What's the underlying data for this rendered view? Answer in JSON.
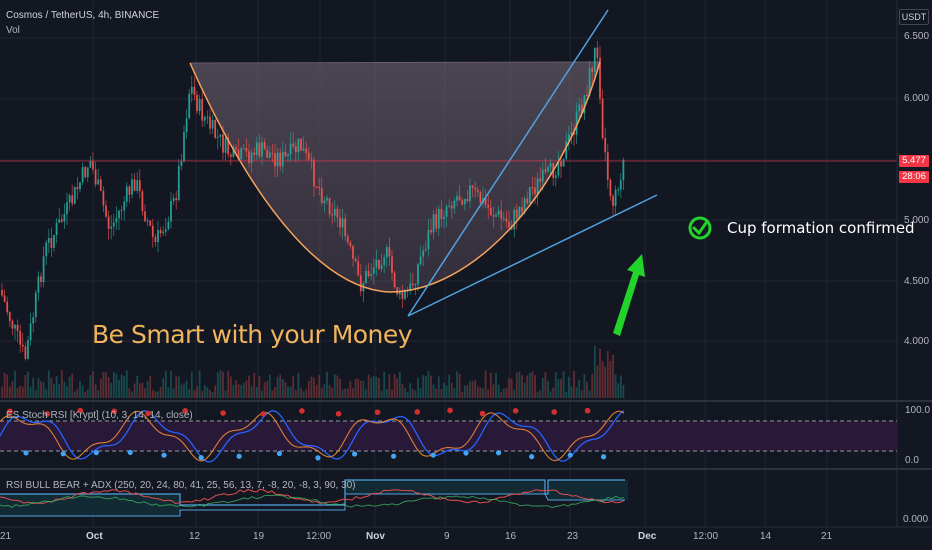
{
  "header": {
    "title": "Cosmos / TetherUS, 4h, BINANCE",
    "sub": "Vol"
  },
  "price_axis": {
    "unit": "USDT",
    "ticks": [
      "6.500",
      "6.000",
      "5.500",
      "5.000",
      "4.500",
      "4.000"
    ],
    "last_price": "5.477",
    "countdown": "28:06"
  },
  "time_axis": {
    "labels": [
      "21",
      "Oct",
      "12",
      "19",
      "12:00",
      "Nov",
      "9",
      "16",
      "23",
      "Dec",
      "12:00",
      "14",
      "21"
    ]
  },
  "indicators": {
    "stoch_label": "ES Stoch RSI [Krypt] (10, 3, 14, 14, close)",
    "stoch_ticks": [
      "100.0",
      "0.0"
    ],
    "adx_label": "RSI BULL BEAR + ADX (250, 20, 24, 80, 41, 25, 56, 13, 7, -8, 20, -8, 3, 90, 30)",
    "adx_ticks": [
      "0.000"
    ]
  },
  "annotations": {
    "money": "Be Smart with your Money",
    "cup": "Cup formation confirmed"
  },
  "colors": {
    "background": "#131722",
    "up": "#26a69a",
    "down": "#ef5350",
    "cup_line": "#f7a35c",
    "trend": "#4fa3e0",
    "arrow": "#22d32a",
    "badge": "#f23645"
  },
  "icons": {
    "confirm": "check-circle-icon",
    "arrow": "arrow-up-icon"
  }
}
